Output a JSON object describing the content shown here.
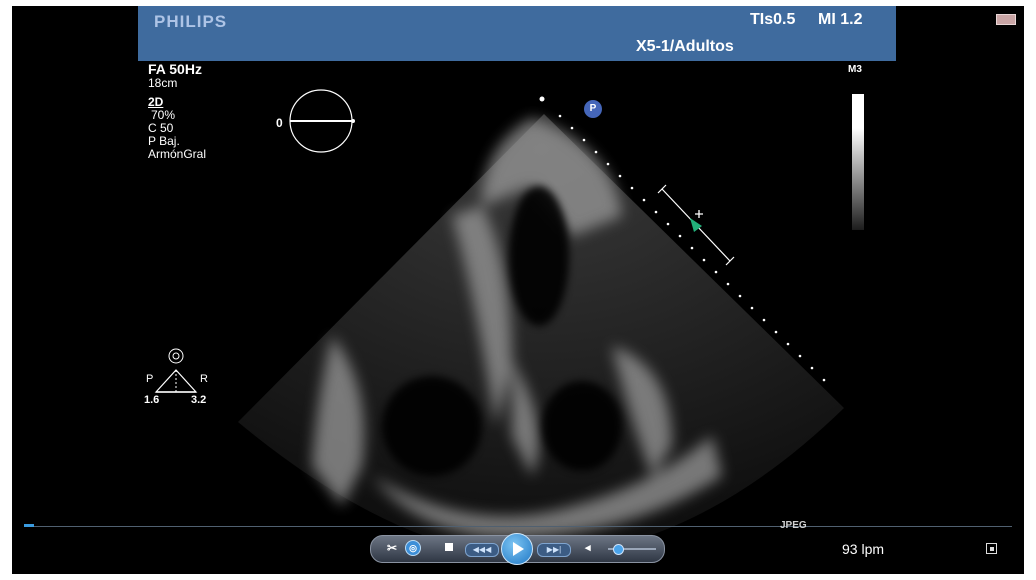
{
  "header": {
    "brand": "PHILIPS",
    "tis": "TIs0.5",
    "mi": "MI 1.2",
    "probe": "X5-1/Adultos"
  },
  "params": {
    "frame_rate": "FA 50Hz",
    "depth": "18cm",
    "mode": "2D",
    "gain": "70%",
    "compress": "C 50",
    "power": "P Baj.",
    "harmonic": "ArmónGral"
  },
  "map": {
    "label": "M3",
    "gradient_colors": [
      "#ffffff",
      "#1c1c1c"
    ]
  },
  "orientation": {
    "angle": "0",
    "probe_marker": "P"
  },
  "triplane": {
    "p_label": "P",
    "r_label": "R",
    "left_value": "1.6",
    "right_value": "3.2"
  },
  "timeline": {
    "progress": 0.01,
    "format": "JPEG"
  },
  "player": {
    "slow_label": "◀◀◀",
    "fast_label": "▶▶|",
    "volume": 0.2,
    "accent": "#3a9be0"
  },
  "status": {
    "heart_rate": "93 lpm"
  },
  "colors": {
    "header": "#3f6b9e",
    "background": "#000000",
    "marker": "#4566b9",
    "caliper_marker": "#22b07a"
  }
}
